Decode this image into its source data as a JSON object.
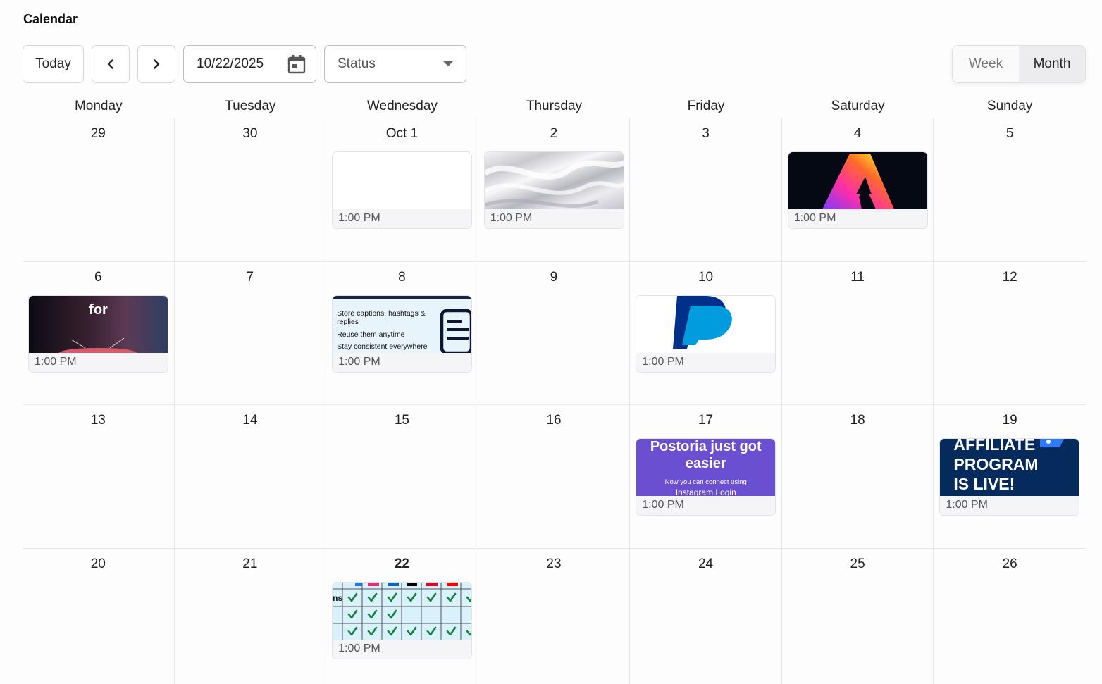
{
  "header": {
    "title": "Calendar"
  },
  "toolbar": {
    "today_label": "Today",
    "date_value": "10/22/2025",
    "status_placeholder": "Status"
  },
  "view_toggle": {
    "week_label": "Week",
    "month_label": "Month",
    "selected": "Month"
  },
  "weekdays": [
    "Monday",
    "Tuesday",
    "Wednesday",
    "Thursday",
    "Friday",
    "Saturday",
    "Sunday"
  ],
  "weeks": [
    [
      "29",
      "30",
      "Oct 1",
      "2",
      "3",
      "4",
      "5"
    ],
    [
      "6",
      "7",
      "8",
      "9",
      "10",
      "11",
      "12"
    ],
    [
      "13",
      "14",
      "15",
      "16",
      "17",
      "18",
      "19"
    ],
    [
      "20",
      "21",
      "22",
      "23",
      "24",
      "25",
      "26"
    ]
  ],
  "today": "22",
  "posts": {
    "oct1": {
      "time": "1:00 PM"
    },
    "oct2": {
      "time": "1:00 PM"
    },
    "oct4": {
      "time": "1:00 PM"
    },
    "oct6": {
      "time": "1:00 PM",
      "thumb_text": "for"
    },
    "oct8": {
      "time": "1:00 PM",
      "thumb_lines": [
        "Store captions, hashtags &",
        "replies",
        "Reuse them anytime",
        "Stay consistent everywhere"
      ]
    },
    "oct10": {
      "time": "1:00 PM"
    },
    "oct17": {
      "time": "1:00 PM",
      "thumb_title": "Postoria just got easier",
      "thumb_sub": "Now you can connect using",
      "thumb_sub2": "Instagram Login"
    },
    "oct19": {
      "time": "1:00 PM",
      "thumb_lines": [
        "AFFILIATE",
        "PROGRAM",
        "IS LIVE!"
      ]
    },
    "oct22": {
      "time": "1:00 PM",
      "thumb_label": "ns"
    }
  },
  "colors": {
    "postoria_purple": "#6b4fd1",
    "affiliate_navy": "#052a5c",
    "check_green": "#15803d",
    "paypal_dark": "#003087",
    "paypal_light": "#009cde"
  }
}
